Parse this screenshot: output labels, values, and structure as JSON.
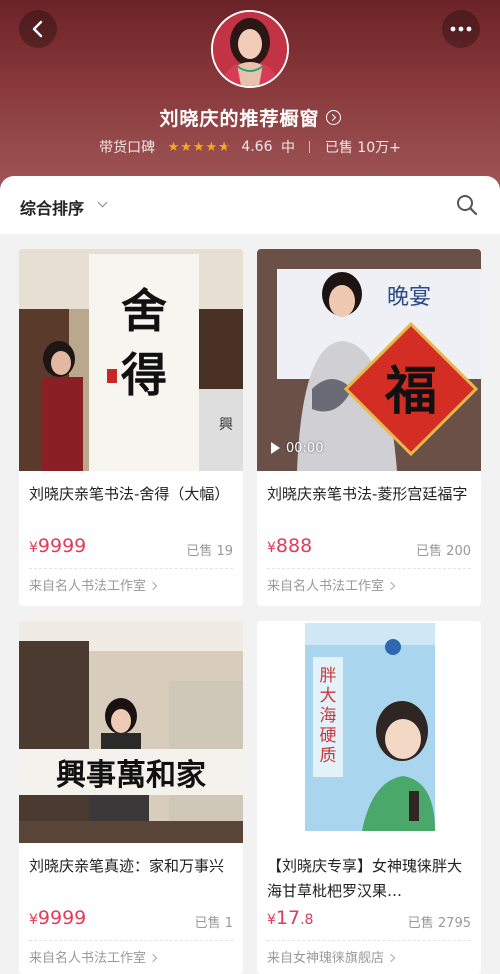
{
  "header": {
    "title": "刘晓庆的推荐橱窗",
    "rating_label": "带货口碑",
    "rating_value": "4.66",
    "rating_level": "中",
    "rating_stars": 4.66,
    "sold_label": "已售 10万+",
    "accent_color": "#e33b5a",
    "star_color": "#f5a623"
  },
  "sort": {
    "label": "综合排序"
  },
  "products": [
    {
      "title": "刘晓庆亲笔书法-舍得（大幅）",
      "currency": "¥",
      "price": "9999",
      "price_decimal": "",
      "sold": "已售 19",
      "store": "来自名人书法工作室",
      "image_alt": "calligraphy 舍得"
    },
    {
      "title": "刘晓庆亲笔书法-菱形宫廷福字",
      "currency": "¥",
      "price": "888",
      "price_decimal": "",
      "sold": "已售 200",
      "store": "来自名人书法工作室",
      "video_time": "00:00",
      "image_alt": "福"
    },
    {
      "title": "刘晓庆亲笔真迹：家和万事兴",
      "currency": "¥",
      "price": "9999",
      "price_decimal": "",
      "sold": "已售 1",
      "store": "来自名人书法工作室",
      "image_alt": "家和萬事興"
    },
    {
      "title": "【刘晓庆专享】女神瑰徕胖大海甘草枇杷罗汉果…",
      "currency": "¥",
      "price": "17",
      "price_decimal": ".8",
      "sold": "已售 2795",
      "store": "来自女神瑰徕旗舰店",
      "image_alt": "胖大海硬质糖果"
    }
  ]
}
